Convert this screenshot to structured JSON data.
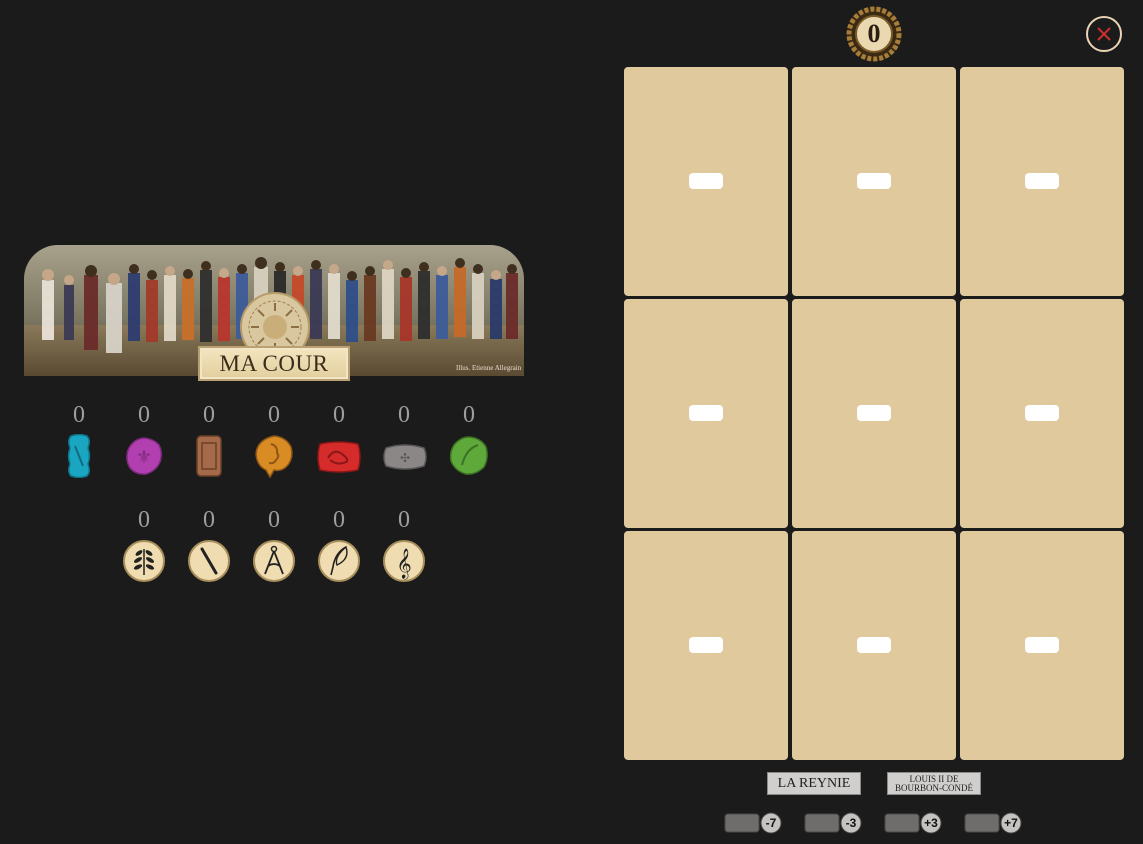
{
  "banner": {
    "title": "MA COUR",
    "credit": "Illus. Etienne Allegrain"
  },
  "resources": {
    "seals": [
      {
        "icon": "blue-seal-icon",
        "count": "0",
        "color": "#1aa5c0"
      },
      {
        "icon": "purple-fleur-de-lis-seal-icon",
        "count": "0",
        "color": "#b23fb0"
      },
      {
        "icon": "brown-seal-icon",
        "count": "0",
        "color": "#a56a4a"
      },
      {
        "icon": "orange-profile-seal-icon",
        "count": "0",
        "color": "#d98b24"
      },
      {
        "icon": "red-seal-icon",
        "count": "0",
        "color": "#d52b2b"
      },
      {
        "icon": "grey-seal-icon",
        "count": "0",
        "color": "#8a8786"
      },
      {
        "icon": "green-seal-icon",
        "count": "0",
        "color": "#5fa83a"
      }
    ],
    "skills": [
      {
        "icon": "laurel-token-icon",
        "count": "0"
      },
      {
        "icon": "baton-token-icon",
        "count": "0"
      },
      {
        "icon": "compass-token-icon",
        "count": "0"
      },
      {
        "icon": "quill-token-icon",
        "count": "0"
      },
      {
        "icon": "treble-clef-token-icon",
        "count": "0"
      }
    ]
  },
  "score": {
    "value": "0"
  },
  "close_icon": "close-icon",
  "slots": [
    {
      "name": "slot-1"
    },
    {
      "name": "slot-2"
    },
    {
      "name": "slot-3"
    },
    {
      "name": "slot-4"
    },
    {
      "name": "slot-5"
    },
    {
      "name": "slot-6"
    },
    {
      "name": "slot-7"
    },
    {
      "name": "slot-8"
    },
    {
      "name": "slot-9"
    }
  ],
  "characters": [
    {
      "label": "LA REYNIE"
    },
    {
      "label_line1": "LOUIS II DE",
      "label_line2": "BOURBON-CONDÉ"
    }
  ],
  "modifiers": [
    {
      "label": "-7"
    },
    {
      "label": "-3"
    },
    {
      "label": "+3"
    },
    {
      "label": "+7"
    }
  ],
  "colors": {
    "background": "#1b1b1c",
    "slot": "#e0c99c",
    "close_ring": "#ebd3b6",
    "close_x": "#c9302c"
  }
}
